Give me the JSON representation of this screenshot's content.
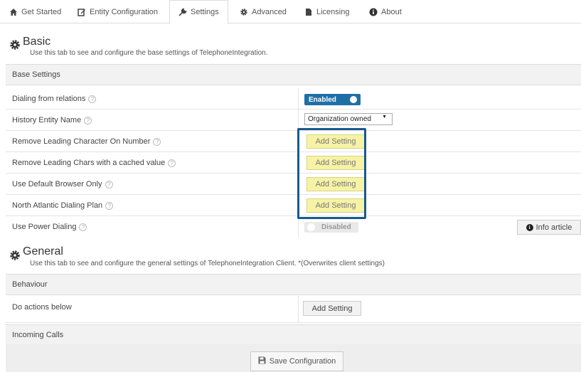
{
  "tabs": [
    {
      "label": "Get Started",
      "icon": "home-icon"
    },
    {
      "label": "Entity Configuration",
      "icon": "edit-icon"
    },
    {
      "label": "Settings",
      "icon": "wrench-icon",
      "active": true
    },
    {
      "label": "Advanced",
      "icon": "gear-icon"
    },
    {
      "label": "Licensing",
      "icon": "document-icon"
    },
    {
      "label": "About",
      "icon": "info-icon"
    }
  ],
  "basic": {
    "title": "Basic",
    "description": "Use this tab to see and configure the base settings of TelephoneIntegration.",
    "band": "Base Settings",
    "rows": [
      {
        "label": "Dialing from relations",
        "control": "Enabled"
      },
      {
        "label": "History Entity Name",
        "control": "Organization owned"
      },
      {
        "label": "Remove Leading Character On Number",
        "control": "Add Setting"
      },
      {
        "label": "Remove Leading Chars with a cached value",
        "control": "Add Setting"
      },
      {
        "label": "Use Default Browser Only",
        "control": "Add Setting"
      },
      {
        "label": "North Atlantic Dialing Plan",
        "control": "Add Setting"
      },
      {
        "label": "Use Power Dialing",
        "control": "Disabled"
      }
    ],
    "info_article": "Info article"
  },
  "general": {
    "title": "General",
    "description": "Use this tab to see and configure the general settings of TelephoneIntegration Client. *(Overwrites client settings)",
    "band_behaviour": "Behaviour",
    "row_label": "Do actions below",
    "row_button": "Add Setting",
    "band_incoming": "Incoming Calls"
  },
  "help_glyph": "?",
  "save_button": "Save Configuration",
  "colors": {
    "accent": "#1f6fa7",
    "highlight": "#f7f3a6",
    "frame": "#1a5a8a"
  }
}
